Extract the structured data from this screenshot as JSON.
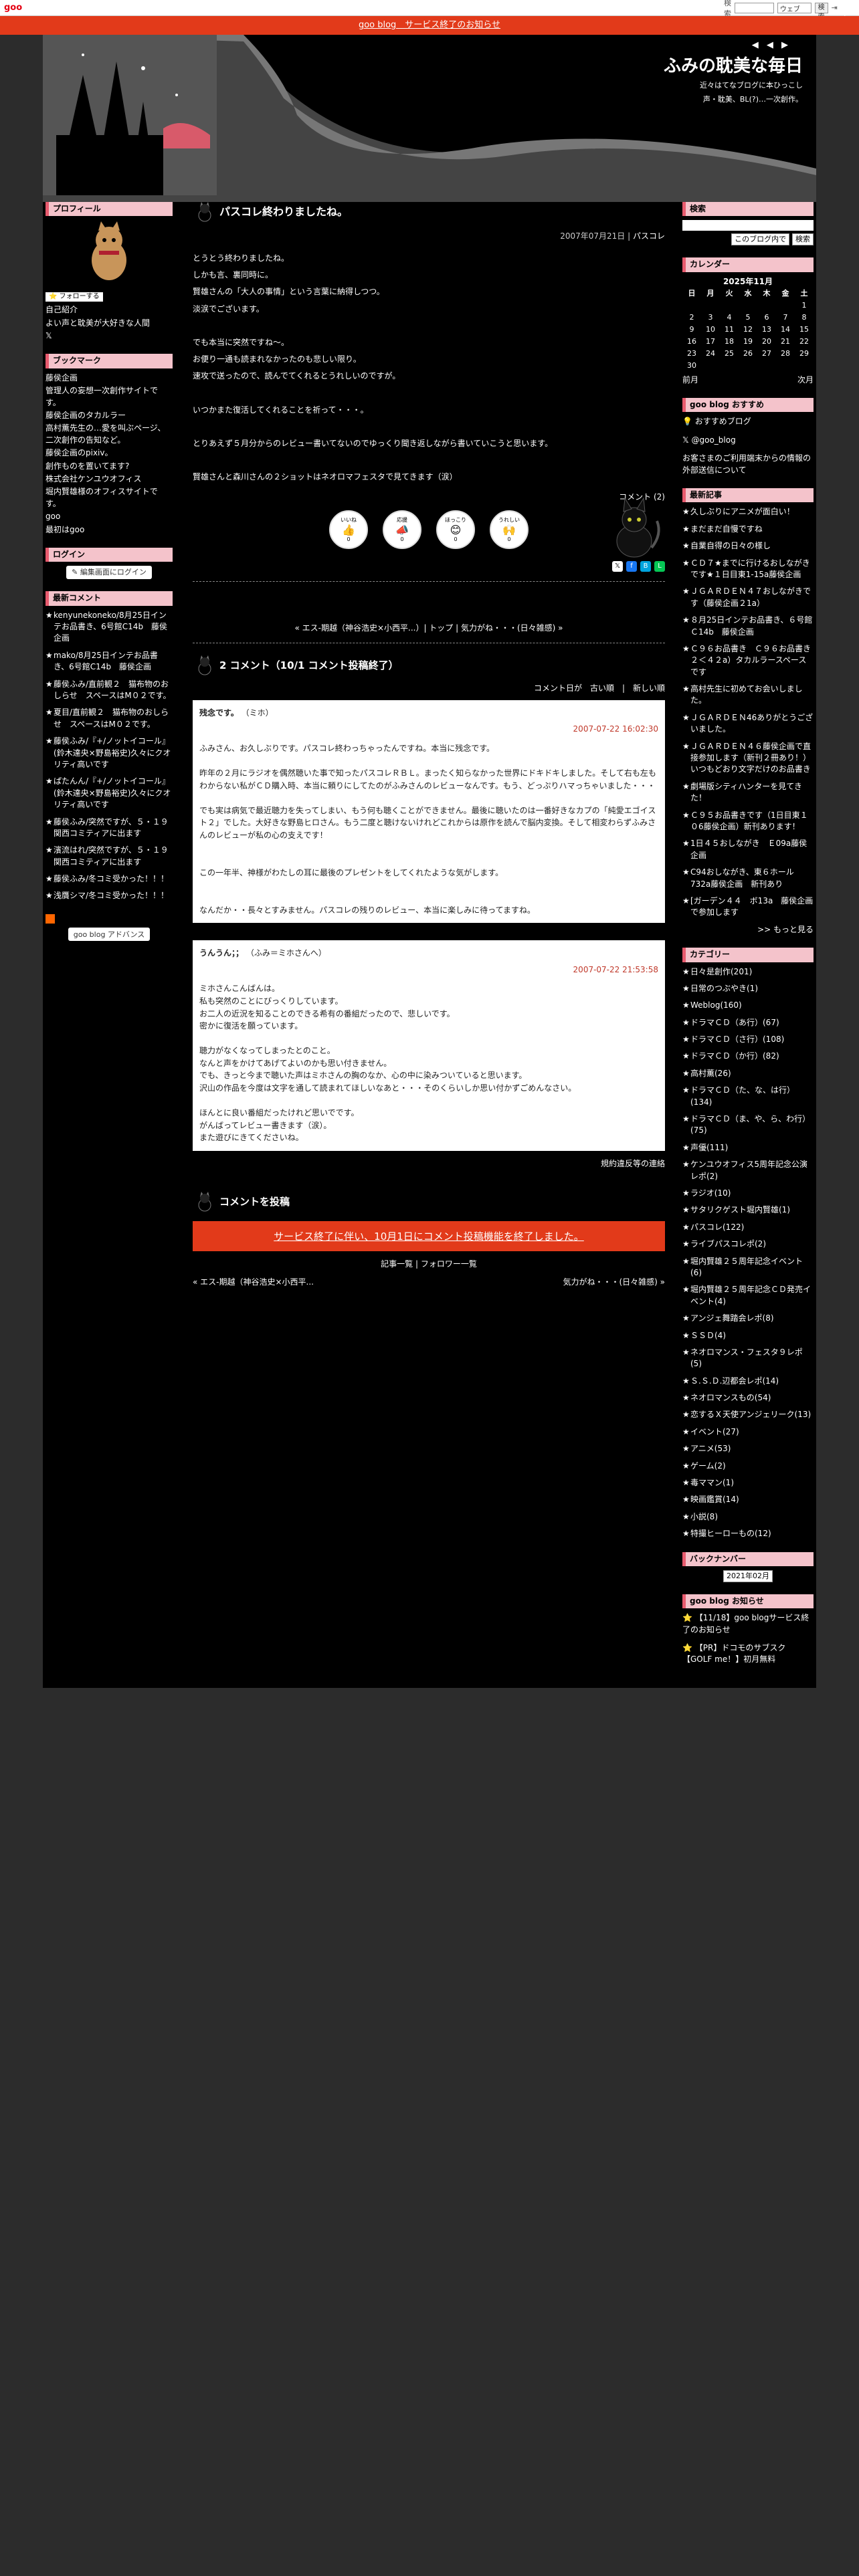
{
  "gbar": {
    "logo": "goo",
    "links": [
      "ブログ",
      "ランダム",
      "goo blog引越し体験版"
    ],
    "search_label": "検索",
    "select_value": "ウェブ",
    "search_button": "検索",
    "login": "ログイン"
  },
  "notice": {
    "text": "goo blog　サービス終了のお知らせ"
  },
  "header": {
    "nav": "◀ ◀ ▶",
    "title": "ふみの耽美な毎日",
    "desc": [
      "近々はてなブログに本ひっこし",
      "声・耽美、BL(?)…一次創作。"
    ]
  },
  "left": {
    "profile": {
      "heading": "プロフィール",
      "follow": "フォローする",
      "links": [
        "自己紹介",
        "よい声と耽美が大好きな人間"
      ]
    },
    "bookmark": {
      "heading": "ブックマーク",
      "items": [
        "藤侯企画",
        "管理人の妄想一次創作サイトです。",
        "藤侯企画のタカルラー",
        "高村薫先生の…愛を叫ぶページ、二次創作の告知など。",
        "藤侯企画のpixiv。",
        "創作ものを置いてます?",
        "株式会社ケンユウオフィス",
        "堀内賢雄様のオフィスサイトです。",
        "goo",
        "最初はgoo"
      ]
    },
    "login": {
      "heading": "ログイン",
      "button": "編集画面にログイン"
    },
    "comments": {
      "heading": "最新コメント",
      "items": [
        "kenyunekoneko/8月25日インテお品書き、6号館C14b　藤侯企画",
        "mako/8月25日インテお品書き、6号館C14b　藤侯企画",
        "藤侯ふみ/直前観２　猫布物のおしらせ　スペースはM０２です。",
        "夏目/直前観２　猫布物のおしらせ　スペースはM０２です。",
        "藤侯ふみ/『+/ノットイコール』(鈴木達央×野島裕史)久々にクオリティ高いです",
        "ぱたんん/『+/ノットイコール』(鈴木達央×野島裕史)久々にクオリティ高いです",
        "藤侯ふみ/突然ですが、５・１９関西コミティアに出ます",
        "濱流はれ/突然ですが、５・１９関西コミティアに出ます",
        "藤侯ふみ/冬コミ受かった！！！",
        "浅贋シマ/冬コミ受かった！！！"
      ]
    },
    "adv": "goo blog アドバンス"
  },
  "entry": {
    "title": "パスコレ終わりましたね。",
    "date": "2007年07月21日",
    "category": "パスコレ",
    "body": [
      "とうとう終わりましたね。",
      "しかも言、裏同時に。",
      "賢雄さんの「大人の事情」という言葉に納得しつつ。",
      "淡涙でございます。",
      "",
      "でも本当に突然ですね〜。",
      "お便り一通も読まれなかったのも悲しい限り。",
      "速攻で送ったので、読んでてくれるとうれしいのですが。",
      "",
      "いつかまた復活してくれることを祈って・・・。",
      "",
      "とりあえず５月分からのレビュー書いてないのでゆっくり聞き返しながら書いていこうと思います。",
      "",
      "賢雄さんと森川さんの２ショットはネオロマフェスタで見てきます（涙）"
    ],
    "comment_link": "コメント (2)",
    "reactions": [
      {
        "label": "いいね",
        "emoji": "👍",
        "count": "0"
      },
      {
        "label": "応援",
        "emoji": "📣",
        "count": "0"
      },
      {
        "label": "ほっこり",
        "emoji": "😊",
        "count": "0"
      },
      {
        "label": "うれしい",
        "emoji": "🙌",
        "count": "0"
      }
    ],
    "nav": "« エス-期越（神谷浩史×小西平...）| トップ | 気力がね・・・(日々雑感) »"
  },
  "comments_section": {
    "title": "2 コメント（10/1 コメント投稿終了）",
    "order": "コメント日が　古い順　|　新しい順",
    "items": [
      {
        "name": "残念です。",
        "sub": "（ミホ）",
        "date": "2007-07-22 16:02:30",
        "text": [
          "ふみさん、お久しぶりです。パスコレ終わっちゃったんですね。本当に残念です。",
          "",
          "昨年の２月にラジオを偶然聴いた事で知ったパスコレＲＢＬ。まったく知らなかった世界にドキドキしました。そして右も左もわからない私がＣＤ購入時、本当に頼りにしてたのがふみさんのレビューなんです。もう、どっぷりハマっちゃいました・・・",
          "",
          "でも実は病気で最近聴力を失ってしまい、もう何も聴くことができません。最後に聴いたのは一番好きなカプの「純愛エゴイスト２」でした。大好きな野島ヒロさん。もう二度と聴けないけれどこれからは原作を読んで脳内変換。そして相変わらずふみさんのレビューが私の心の支えです！",
          "",
          "",
          "この一年半、神様がわたしの耳に最後のプレゼントをしてくれたような気がします。",
          "",
          "",
          "なんだか・・長々とすみません。パスコレの残りのレビュー、本当に楽しみに待ってますね。"
        ]
      },
      {
        "name": "うんうん；；",
        "sub": "（ふみ＝ミホさんへ）",
        "date": "2007-07-22 21:53:58",
        "text": [
          "ミホさんこんばんは。",
          "私も突然のことにびっくりしています。",
          "お二人の近況を知ることのできる希有の番組だったので、悲しいです。",
          "密かに復活を願っています。",
          "",
          "聴力がなくなってしまったとのこと。",
          "なんと声をかけてあげてよいのかも思い付きません。",
          "でも、きっと今まで聴いた声はミホさんの胸のなか、心の中に染みついていると思います。",
          "沢山の作品を今度は文字を通して読まれてほしいなあと・・・そのくらいしか思い付かずごめんなさい。",
          "",
          "ほんとに良い番組だったけれど思いでです。",
          "がんばってレビュー書きます（涙）。",
          "また遊びにきてくださいね。"
        ]
      }
    ],
    "report": "規約違反等の連絡"
  },
  "post": {
    "title": "コメントを投稿",
    "closed": "サービス終了に伴い、10月1日にコメント投稿機能を終了しました。",
    "links": "記事一覧 | フォロワー一覧",
    "prev": "« エス-期越（神谷浩史×小西平...",
    "next": "気力がね・・・(日々雑感) »"
  },
  "right": {
    "search": {
      "heading": "検索",
      "select": "このブログ内で",
      "button": "検索"
    },
    "calendar": {
      "heading": "カレンダー",
      "month": "2025年11月",
      "days": [
        "日",
        "月",
        "火",
        "水",
        "木",
        "金",
        "土"
      ],
      "rows": [
        [
          "",
          "",
          "",
          "",
          "",
          "",
          "1"
        ],
        [
          "2",
          "3",
          "4",
          "5",
          "6",
          "7",
          "8"
        ],
        [
          "9",
          "10",
          "11",
          "12",
          "13",
          "14",
          "15"
        ],
        [
          "16",
          "17",
          "18",
          "19",
          "20",
          "21",
          "22"
        ],
        [
          "23",
          "24",
          "25",
          "26",
          "27",
          "28",
          "29"
        ],
        [
          "30",
          "",
          "",
          "",
          "",
          "",
          ""
        ]
      ],
      "prev": "前月",
      "next": "次月"
    },
    "goo": {
      "heading": "goo blog おすすめ",
      "items": [
        "おすすめブログ",
        "@goo_blog",
        "お客さまのご利用端末からの情報の外部送信について"
      ]
    },
    "recent": {
      "heading": "最新記事",
      "items": [
        "久しぶりにアニメが面白い！",
        "まだまだ自慢ですね",
        "自業自得の日々の様し",
        "ＣＤ７★までに行けるおしながきです★１日目東1-15a藤侯企画",
        "ＪＧＡＲＤＥＮ４７おしながきです（藤侯企画２1a）",
        "８月25日インテお品書き、６号館Ｃ14b　藤侯企画",
        "Ｃ９６お品書き　Ｃ９６お品書き　２＜４２a）タカルラースペースです",
        "高村先生に初めてお会いしました。",
        "ＪＧＡＲＤＥＮ46ありがとうございました。",
        "ＪＧＡＲＤＥＮ４６藤侯企画で直接参加します（新刊２冊あり！）いつもどおり文字だけのお品書き",
        "劇場版シティハンターを見てきた！",
        "Ｃ９５お品書きです（1日目東１０6藤侯企画）新刊あります！",
        "1日４５おしながき　Ｅ09a藤侯企画",
        "C94おしながき、東６ホール732a藤侯企画　新刊あり",
        "[ガーデン４４　ボ13a　藤侯企画で参加します"
      ],
      "more": ">> もっと見る"
    },
    "category": {
      "heading": "カテゴリー",
      "items": [
        "日々是創作(201)",
        "日常のつぶやき(1)",
        "Weblog(160)",
        "ドラマＣＤ（あ行）(67)",
        "ドラマＣＤ（さ行）(108)",
        "ドラマＣＤ（か行）(82)",
        "高村薫(26)",
        "ドラマＣＤ（た、な、は行）(134)",
        "ドラマＣＤ（ま、や、ら、わ行）(75)",
        "声優(111)",
        "ケンユウオフィス5周年記念公演レポ(2)",
        "ラジオ(10)",
        "サタリクゲスト堀内賢雄(1)",
        "パスコレ(122)",
        "ライブパスコレポ(2)",
        "堀内賢雄２５周年記念イベント(6)",
        "堀内賢雄２５周年記念ＣＤ発売イベント(4)",
        "アンジェ舞踏会レポ(8)",
        "ＳＳＤ(4)",
        "ネオロマンス・フェスタ９レポ(5)",
        "Ｓ.Ｓ.Ｄ.辺都会レポ(14)",
        "ネオロマンスもの(54)",
        "恋するＸ天使アンジェリーク(13)",
        "イベント(27)",
        "アニメ(53)",
        "ゲーム(2)",
        "毒ママン(1)",
        "映画鑑賞(14)",
        "小説(8)",
        "特撮ヒーローもの(12)"
      ]
    },
    "backnumber": {
      "heading": "バックナンバー",
      "select": "2021年02月"
    },
    "news": {
      "heading": "goo blog お知らせ",
      "items": [
        "【11/18】goo blogサービス終了のお知らせ",
        "【PR】ドコモのサブスク【GOLF me！】初月無料"
      ]
    }
  }
}
